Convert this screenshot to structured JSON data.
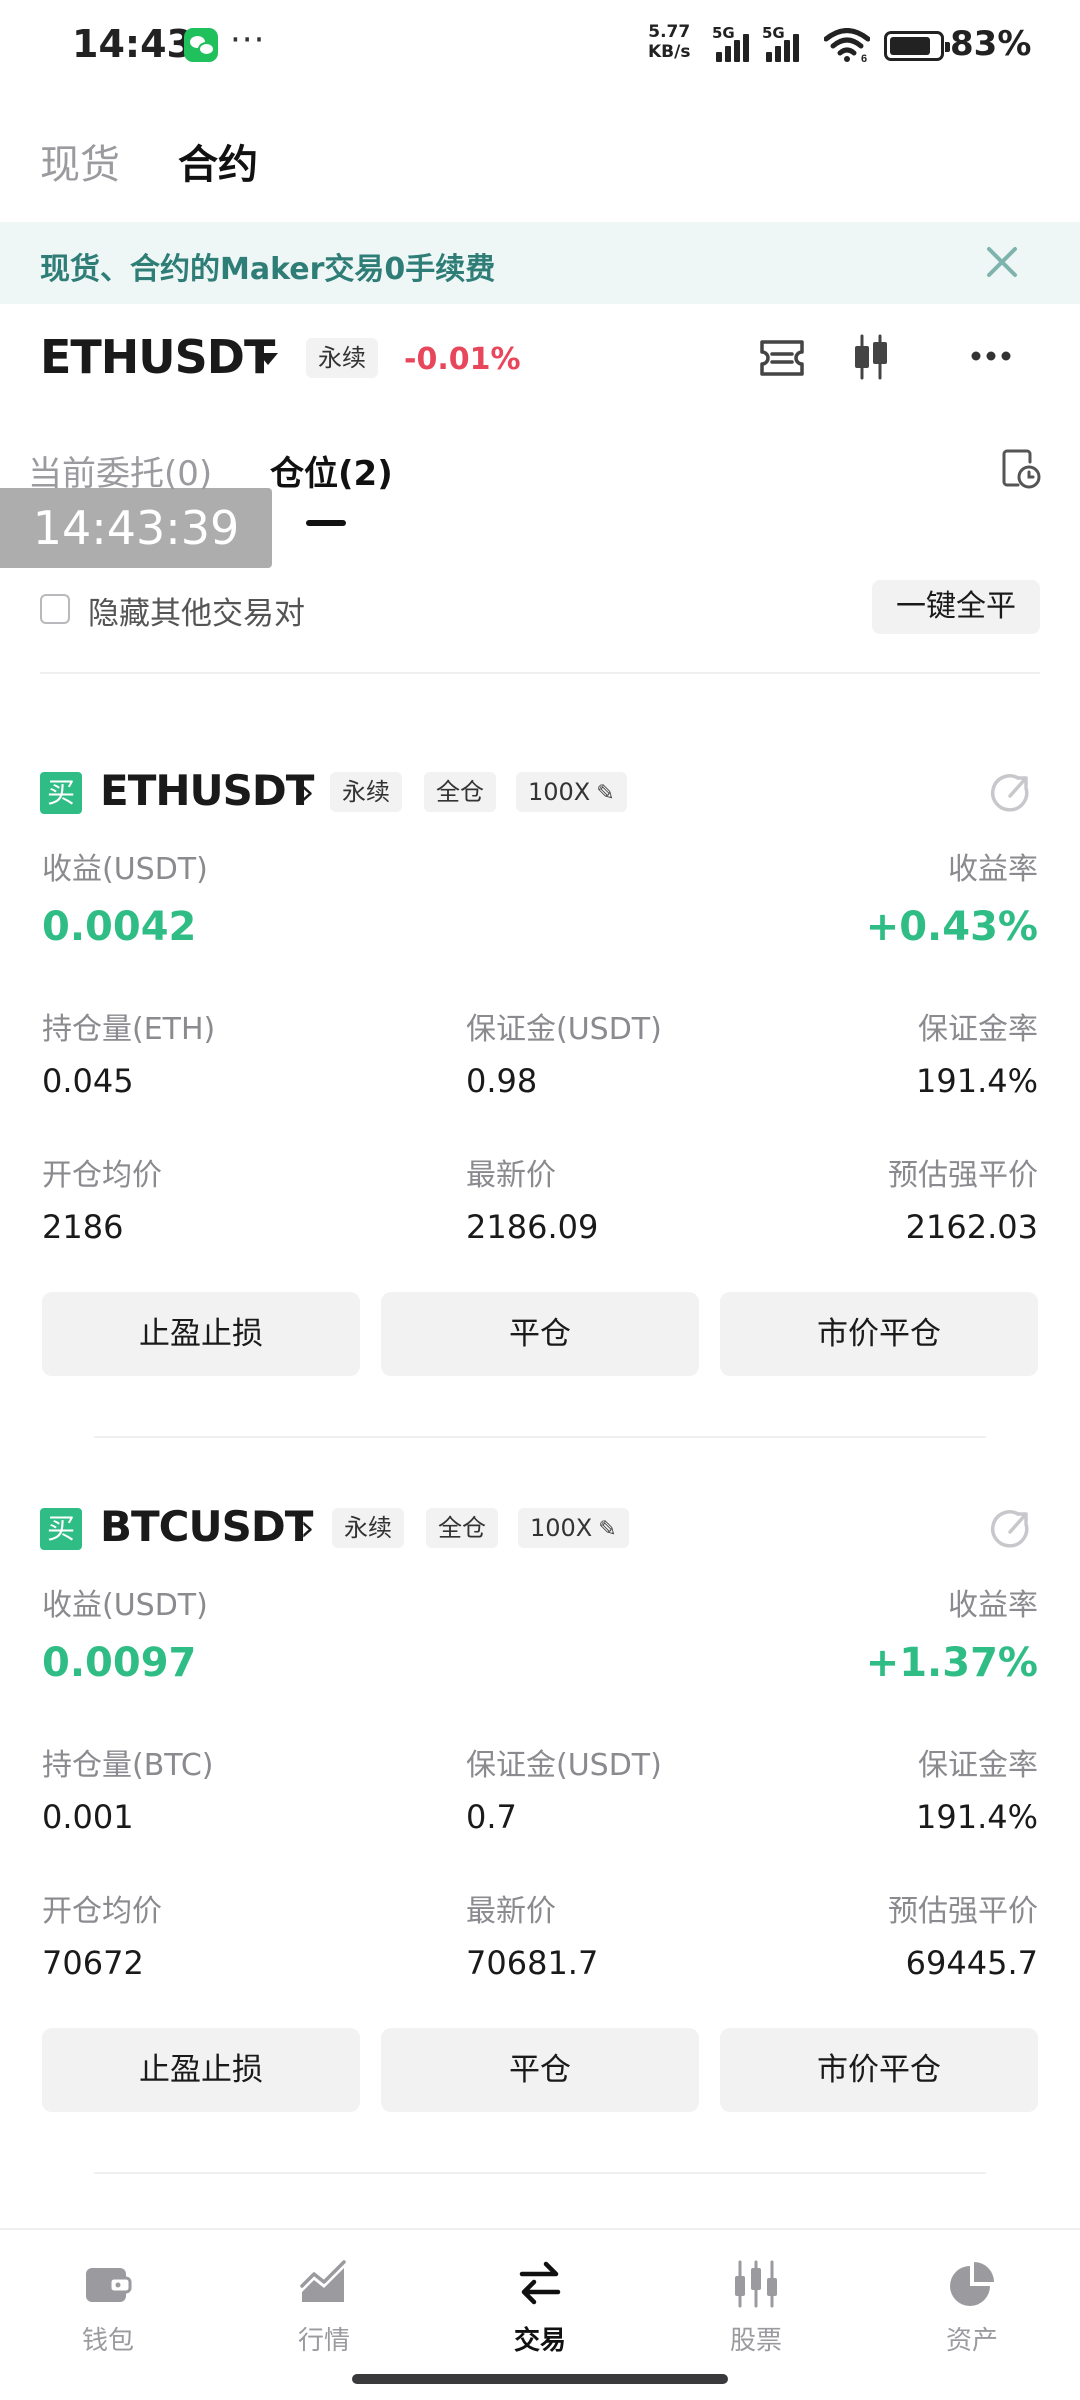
{
  "status_bar": {
    "time": "14:43",
    "more": "···",
    "net_speed_value": "5.77",
    "net_speed_unit": "KB/s",
    "sim1": "5G",
    "sim2": "5G",
    "wifi_badge": "6",
    "battery_percent": "83%",
    "battery_level": 0.83
  },
  "top_tabs": [
    {
      "label": "现货",
      "active": false
    },
    {
      "label": "合约",
      "active": true
    }
  ],
  "banner": {
    "text": "现货、合约的Maker交易0手续费"
  },
  "pair_header": {
    "symbol": "ETHUSDT",
    "type_tag": "永续",
    "change": "-0.01%",
    "change_color": "#e8465b"
  },
  "sub_tabs": [
    {
      "label": "当前委托(0)",
      "active": false
    },
    {
      "label": "仓位(2)",
      "active": true
    }
  ],
  "time_overlay": "14:43:39",
  "filters": {
    "hide_others_label": "隐藏其他交易对",
    "hide_others_checked": false,
    "close_all_label": "一键全平"
  },
  "labels": {
    "pnl": "收益(USDT)",
    "roe": "收益率",
    "margin": "保证金(USDT)",
    "margin_ratio": "保证金率",
    "entry_price": "开仓均价",
    "last_price": "最新价",
    "liq_price": "预估强平价",
    "tp_sl": "止盈止损",
    "close": "平仓",
    "market_close": "市价平仓"
  },
  "positions": [
    {
      "side": "买",
      "symbol": "ETHUSDT",
      "type": "永续",
      "margin_mode": "全仓",
      "leverage": "100X",
      "pnl": "0.0042",
      "roe": "+0.43%",
      "size_label": "持仓量(ETH)",
      "size": "0.045",
      "margin": "0.98",
      "margin_ratio": "191.4%",
      "entry_price": "2186",
      "last_price": "2186.09",
      "liq_price": "2162.03"
    },
    {
      "side": "买",
      "symbol": "BTCUSDT",
      "type": "永续",
      "margin_mode": "全仓",
      "leverage": "100X",
      "pnl": "0.0097",
      "roe": "+1.37%",
      "size_label": "持仓量(BTC)",
      "size": "0.001",
      "margin": "0.7",
      "margin_ratio": "191.4%",
      "entry_price": "70672",
      "last_price": "70681.7",
      "liq_price": "69445.7"
    }
  ],
  "colors": {
    "profit": "#2fbd85",
    "loss": "#e8465b",
    "banner_bg": "#eef7f6",
    "banner_text": "#2f7d77"
  },
  "bottom_nav": [
    {
      "label": "钱包",
      "icon": "wallet-icon",
      "active": false
    },
    {
      "label": "行情",
      "icon": "market-chart-icon",
      "active": false
    },
    {
      "label": "交易",
      "icon": "trade-arrows-icon",
      "active": true
    },
    {
      "label": "股票",
      "icon": "stock-candles-icon",
      "active": false
    },
    {
      "label": "资产",
      "icon": "pie-chart-icon",
      "active": false
    }
  ]
}
